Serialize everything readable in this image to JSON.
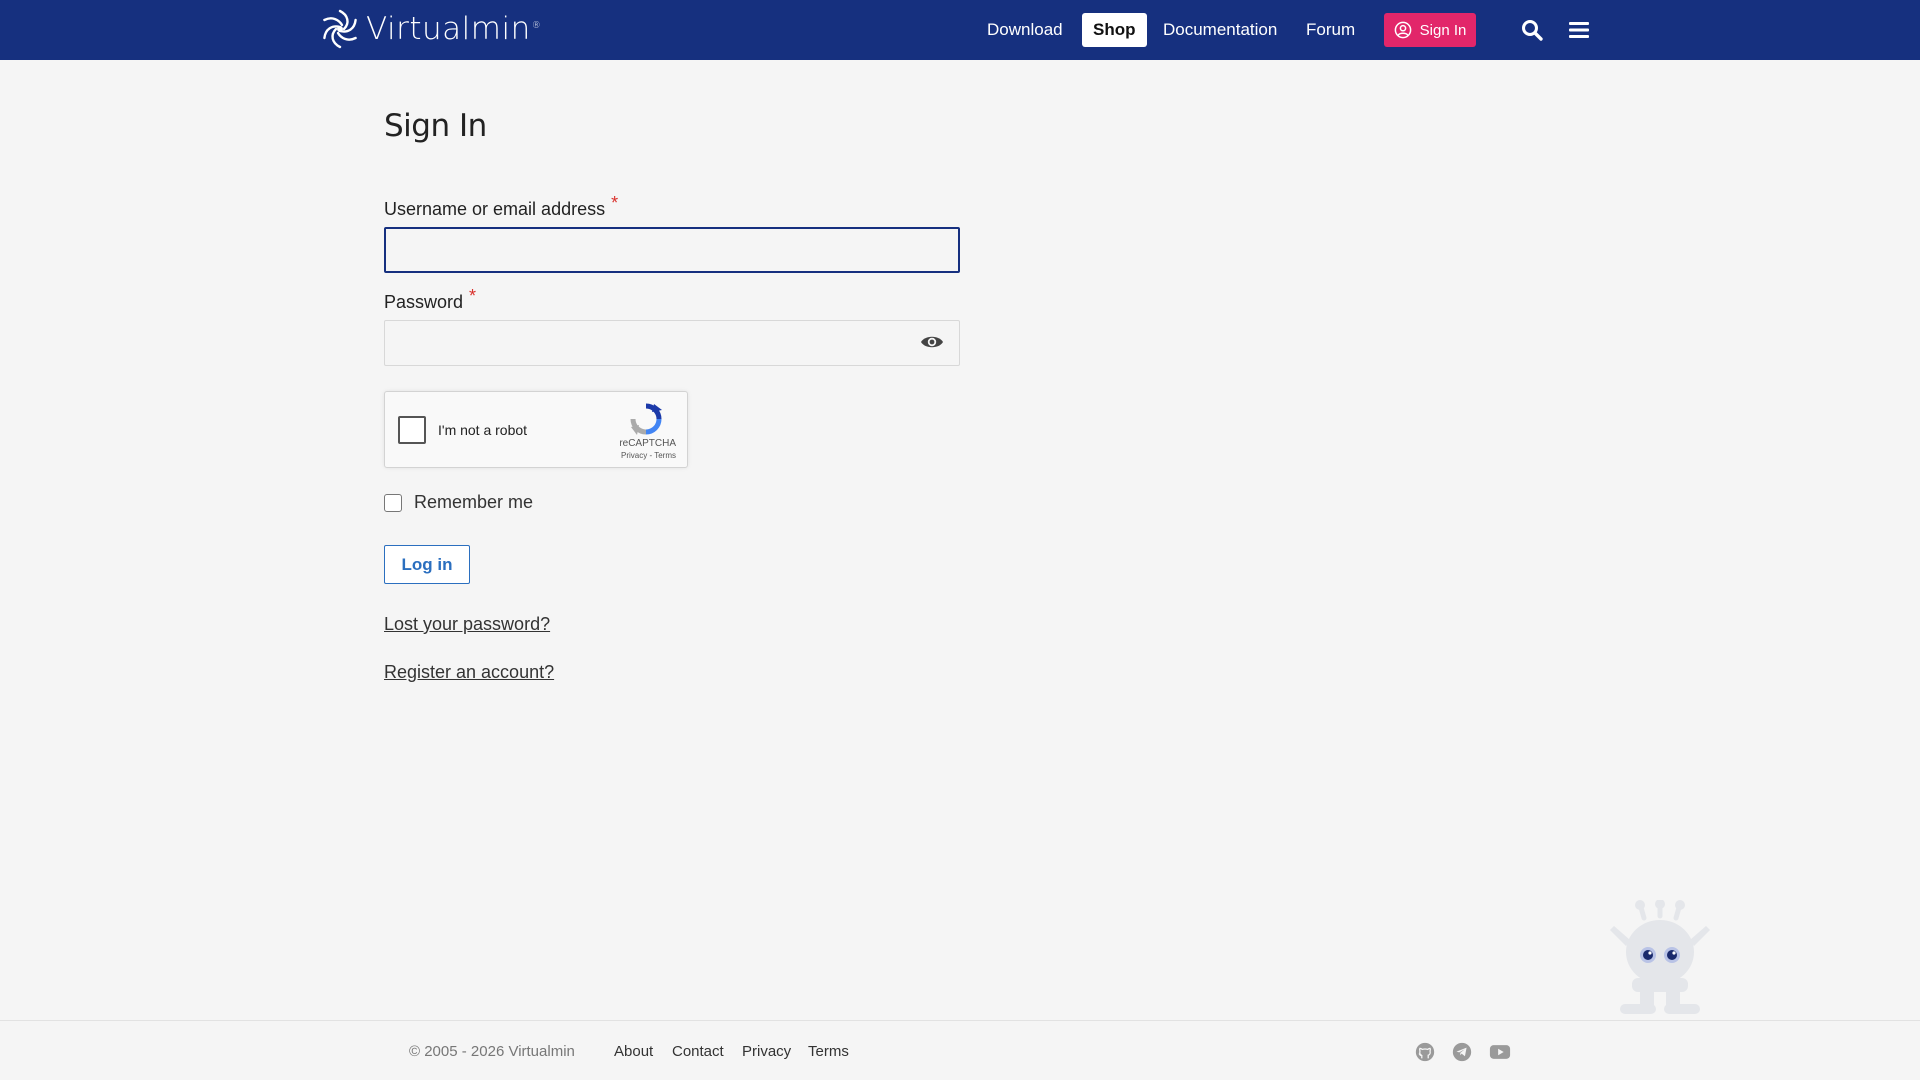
{
  "header": {
    "brand": "Virtualmin",
    "trademark": "®",
    "nav": [
      {
        "label": "Download"
      },
      {
        "label": "Shop"
      },
      {
        "label": "Documentation"
      },
      {
        "label": "Forum"
      }
    ],
    "signin_label": "Sign In",
    "icons": [
      "search-icon",
      "hamburger-menu-icon"
    ],
    "colors": {
      "bar": "#16307f",
      "signin": "#e2266a"
    }
  },
  "main": {
    "title": "Sign In",
    "username_label": "Username or email address",
    "password_label": "Password",
    "required_mark": "*",
    "username_value": "",
    "password_value": "",
    "recaptcha": {
      "text": "I'm not a robot",
      "brand": "reCAPTCHA",
      "links": "Privacy - Terms"
    },
    "remember_label": "Remember me",
    "login_label": "Log in",
    "lost_password": "Lost your password?",
    "register": "Register an account?"
  },
  "footer": {
    "copyright": "© 2005 - 2026 Virtualmin",
    "links": [
      {
        "label": "About"
      },
      {
        "label": "Contact"
      },
      {
        "label": "Privacy"
      },
      {
        "label": "Terms"
      }
    ],
    "social": [
      "github-icon",
      "telegram-icon",
      "youtube-icon"
    ]
  }
}
